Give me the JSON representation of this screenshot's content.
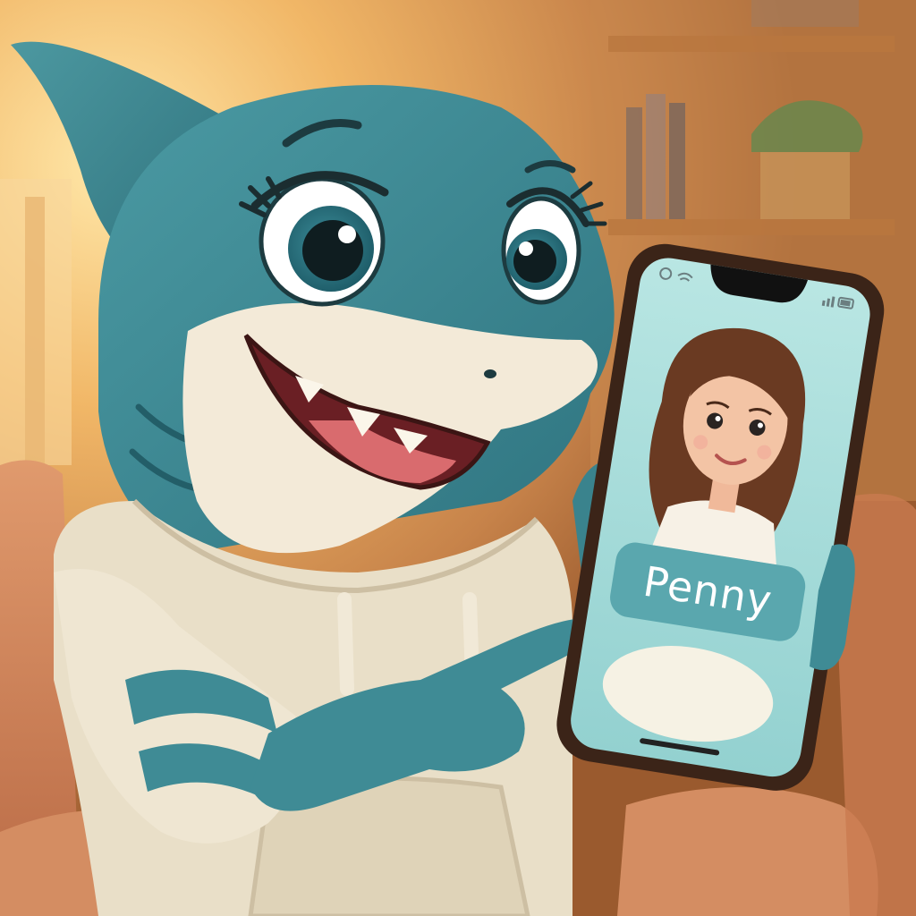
{
  "scene": {
    "description_colors": {
      "shark_body": "#3f8b95",
      "shark_belly": "#f3ead8",
      "hoodie": "#e9dfc8",
      "sofa": "#d98a5e",
      "wall_glow": "#f6c66a",
      "phone_screen": "#a9dcda",
      "name_badge": "#5aa7ae",
      "phone_frame": "#3b2418"
    }
  },
  "phone": {
    "contact_name": "Penny",
    "icons": [
      "wifi-icon",
      "signal-icon",
      "battery-icon",
      "alarm-icon"
    ]
  }
}
